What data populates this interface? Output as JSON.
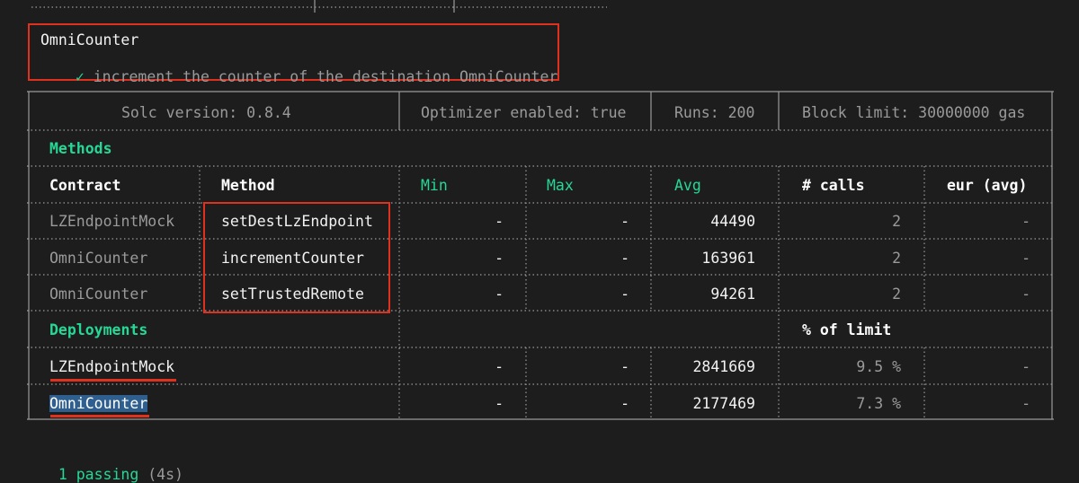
{
  "test": {
    "suite": "OmniCounter",
    "check": "✓",
    "case": "increment the counter of the destination OmniCounter"
  },
  "header": {
    "solc": "Solc version: 0.8.4",
    "optimizer": "Optimizer enabled: true",
    "runs": "Runs: 200",
    "block_limit": "Block limit: 30000000 gas"
  },
  "methods_section": {
    "title": "Methods",
    "columns": {
      "contract": "Contract",
      "method": "Method",
      "min": "Min",
      "max": "Max",
      "avg": "Avg",
      "calls": "# calls",
      "eur": "eur (avg)"
    },
    "rows": [
      {
        "contract": "LZEndpointMock",
        "method": "setDestLzEndpoint",
        "min": "-",
        "max": "-",
        "avg": "44490",
        "calls": "2",
        "eur": "-"
      },
      {
        "contract": "OmniCounter",
        "method": "incrementCounter",
        "min": "-",
        "max": "-",
        "avg": "163961",
        "calls": "2",
        "eur": "-"
      },
      {
        "contract": "OmniCounter",
        "method": "setTrustedRemote",
        "min": "-",
        "max": "-",
        "avg": "94261",
        "calls": "2",
        "eur": "-"
      }
    ]
  },
  "deployments_section": {
    "title": "Deployments",
    "limit_header": "% of limit",
    "rows": [
      {
        "contract": "LZEndpointMock",
        "min": "-",
        "max": "-",
        "avg": "2841669",
        "limit": "9.5 %",
        "eur": "-"
      },
      {
        "contract": "OmniCounter",
        "min": "-",
        "max": "-",
        "avg": "2177469",
        "limit": "7.3 %",
        "eur": "-"
      }
    ]
  },
  "footer": {
    "passing": "1 passing",
    "duration": "(4s)"
  },
  "colors": {
    "background": "#1d1d1d",
    "accent_green": "#27d796",
    "highlight_red": "#e0301e",
    "selection_blue": "#2f5f8f"
  }
}
